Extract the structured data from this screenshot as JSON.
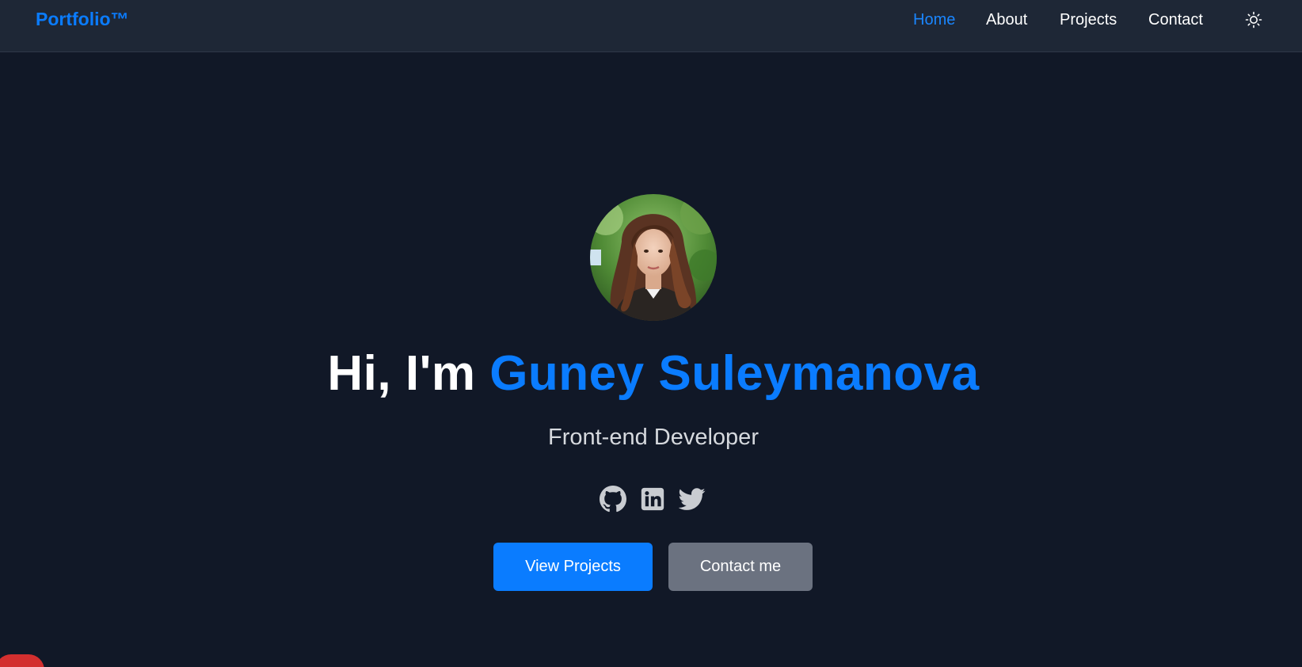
{
  "navbar": {
    "brand": "Portfolio™",
    "links": [
      {
        "label": "Home",
        "active": true
      },
      {
        "label": "About",
        "active": false
      },
      {
        "label": "Projects",
        "active": false
      },
      {
        "label": "Contact",
        "active": false
      }
    ],
    "theme_toggle_icon": "sun-icon"
  },
  "hero": {
    "greeting": "Hi, I'm ",
    "name": "Guney Suleymanova",
    "subtitle": "Front-end Developer",
    "socials": [
      {
        "icon": "github-icon"
      },
      {
        "icon": "linkedin-icon"
      },
      {
        "icon": "twitter-icon"
      }
    ],
    "primary_button": "View Projects",
    "secondary_button": "Contact me"
  },
  "colors": {
    "background": "#111827",
    "navbar": "#1e2736",
    "accent": "#0a7cff",
    "secondary_button": "#6b7280",
    "badge": "#d32f2f"
  }
}
